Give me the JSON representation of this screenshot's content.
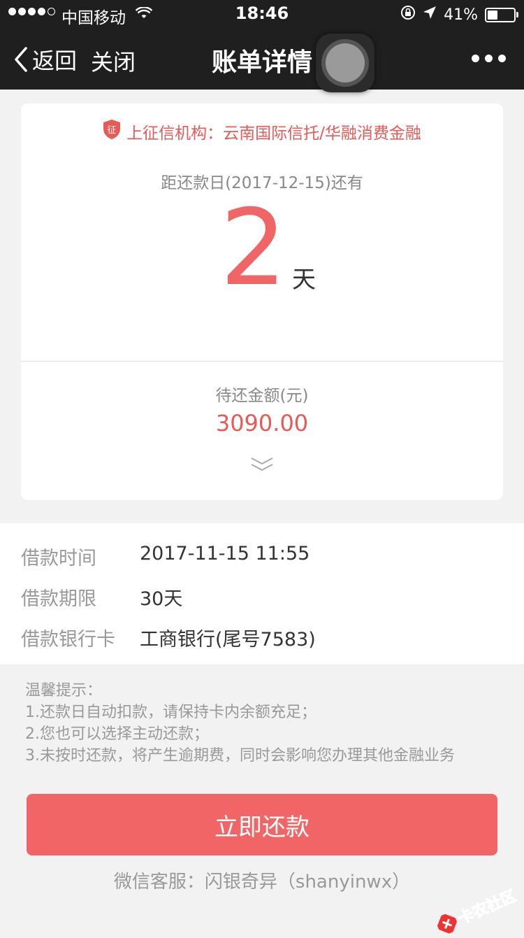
{
  "status_bar": {
    "carrier": "中国移动",
    "time": "18:46",
    "battery": "41%"
  },
  "nav": {
    "back_label": "返回",
    "close_label": "关闭",
    "title": "账单详情"
  },
  "bill": {
    "credit_notice": "上征信机构：云南国际信托/华融消费金融",
    "credit_badge": "征",
    "countdown_label": "距还款日(2017-12-15)还有",
    "days_left": "2",
    "days_unit": "天",
    "due_label": "待还金额(元)",
    "due_amount": "3090.00"
  },
  "loan_info": [
    {
      "key": "借款时间",
      "value": "2017-11-15 11:55"
    },
    {
      "key": "借款期限",
      "value": "30天"
    },
    {
      "key": "借款银行卡",
      "value": "工商银行(尾号7583)"
    }
  ],
  "tips": {
    "title": "温馨提示：",
    "lines": [
      "1.还款日自动扣款，请保持卡内余额充足；",
      "2.您也可以选择主动还款；",
      "3.未按时还款，将产生逾期费，同时会影响您办理其他金融业务"
    ]
  },
  "actions": {
    "pay_now": "立即还款"
  },
  "service": "微信客服：闪银奇异（shanyinwx）",
  "watermark": "卡农社区",
  "colors": {
    "accent": "#f16566",
    "top_bar": "#1f1f1f"
  }
}
